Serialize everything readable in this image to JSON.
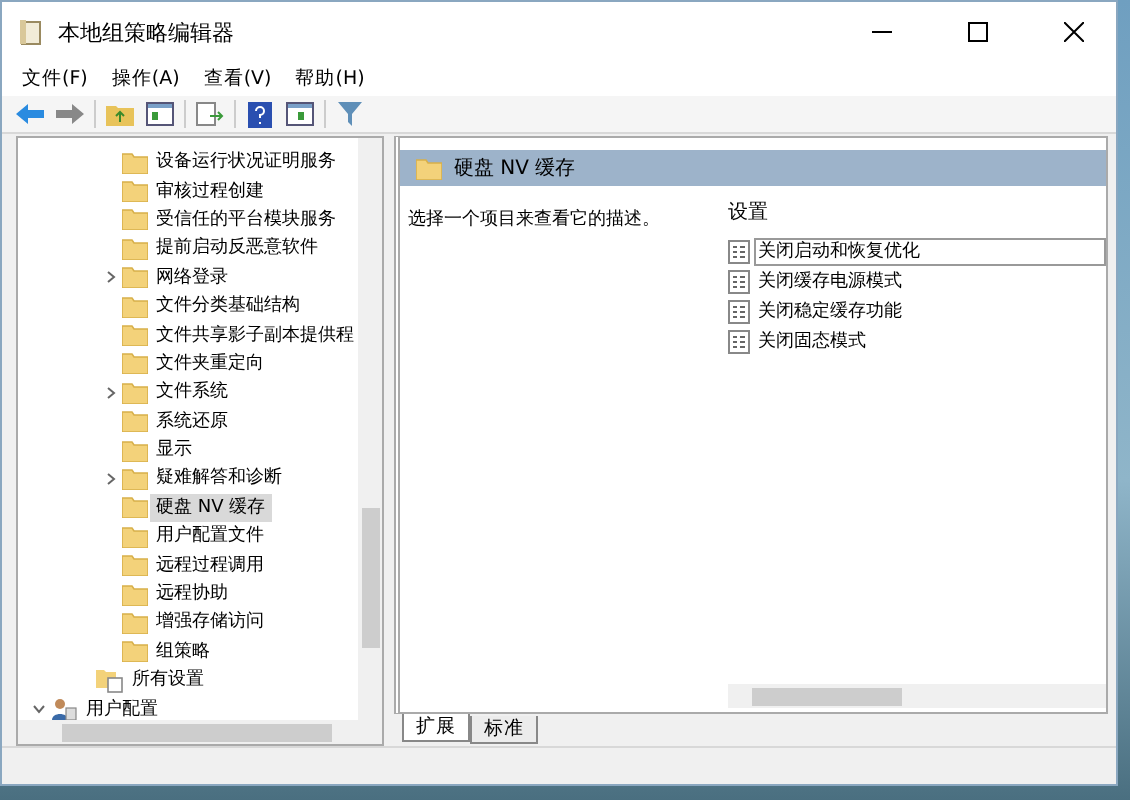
{
  "window": {
    "title": "本地组策略编辑器"
  },
  "menu": [
    "文件(F)",
    "操作(A)",
    "查看(V)",
    "帮助(H)"
  ],
  "tree": {
    "items": [
      {
        "label": "设备运行状况证明服务",
        "kind": "folder",
        "expandable": false,
        "selected": false
      },
      {
        "label": "审核过程创建",
        "kind": "folder",
        "expandable": false,
        "selected": false
      },
      {
        "label": "受信任的平台模块服务",
        "kind": "folder",
        "expandable": false,
        "selected": false
      },
      {
        "label": "提前启动反恶意软件",
        "kind": "folder",
        "expandable": false,
        "selected": false
      },
      {
        "label": "网络登录",
        "kind": "folder",
        "expandable": true,
        "selected": false
      },
      {
        "label": "文件分类基础结构",
        "kind": "folder",
        "expandable": false,
        "selected": false
      },
      {
        "label": "文件共享影子副本提供程",
        "kind": "folder",
        "expandable": false,
        "selected": false
      },
      {
        "label": "文件夹重定向",
        "kind": "folder",
        "expandable": false,
        "selected": false
      },
      {
        "label": "文件系统",
        "kind": "folder",
        "expandable": true,
        "selected": false
      },
      {
        "label": "系统还原",
        "kind": "folder",
        "expandable": false,
        "selected": false
      },
      {
        "label": "显示",
        "kind": "folder",
        "expandable": false,
        "selected": false
      },
      {
        "label": "疑难解答和诊断",
        "kind": "folder",
        "expandable": true,
        "selected": false
      },
      {
        "label": "硬盘 NV 缓存",
        "kind": "folder",
        "expandable": false,
        "selected": true
      },
      {
        "label": "用户配置文件",
        "kind": "folder",
        "expandable": false,
        "selected": false
      },
      {
        "label": "远程过程调用",
        "kind": "folder",
        "expandable": false,
        "selected": false
      },
      {
        "label": "远程协助",
        "kind": "folder",
        "expandable": false,
        "selected": false
      },
      {
        "label": "增强存储访问",
        "kind": "folder",
        "expandable": false,
        "selected": false
      },
      {
        "label": "组策略",
        "kind": "folder",
        "expandable": false,
        "selected": false
      },
      {
        "label": "所有设置",
        "kind": "settings",
        "expandable": false,
        "selected": false
      },
      {
        "label": "用户配置",
        "kind": "user",
        "expandable": true,
        "expanded": true,
        "selected": false
      }
    ]
  },
  "detail": {
    "header": "硬盘 NV 缓存",
    "description": "选择一个项目来查看它的描述。",
    "column_header": "设置",
    "settings": [
      {
        "label": "关闭启动和恢复优化",
        "selected": true
      },
      {
        "label": "关闭缓存电源模式",
        "selected": false
      },
      {
        "label": "关闭稳定缓存功能",
        "selected": false
      },
      {
        "label": "关闭固态模式",
        "selected": false
      }
    ]
  },
  "tabs": [
    {
      "label": "扩展",
      "selected": true
    },
    {
      "label": "标准",
      "selected": false
    }
  ]
}
